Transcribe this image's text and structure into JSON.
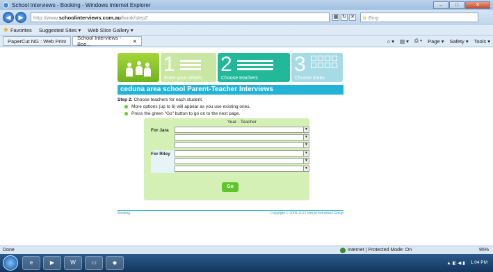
{
  "window": {
    "title": "School Interviews - Booking - Windows Internet Explorer",
    "buttons": [
      "–",
      "□",
      "✕"
    ]
  },
  "address": {
    "url_prefix": "http://www.",
    "url_domain": "schoolinterviews.com.au",
    "url_path": "/book/step2",
    "search_brand": "b",
    "search_placeholder": "Bing"
  },
  "favorites": {
    "items": [
      "Favorites",
      "Suggested Sites ▾",
      "Web Slice Gallery ▾"
    ]
  },
  "tabs": [
    {
      "label": "PaperCut NG : Web Print",
      "active": false
    },
    {
      "label": "School Interviews - Boo...",
      "active": true
    }
  ],
  "command_bar": [
    "Page ▾",
    "Safety ▾",
    "Tools ▾"
  ],
  "steps": [
    {
      "number": "1",
      "label": "Enter your details"
    },
    {
      "number": "2",
      "label": "Choose teachers"
    },
    {
      "number": "3",
      "label": "Choose times"
    }
  ],
  "page": {
    "heading": "ceduna area school Parent-Teacher Interviews",
    "step_bold": "Step 2:",
    "step_text": " Choose teachers for each student.",
    "bullets": [
      "More options (up to 6) will appear as you use existing ones.",
      "Press the green \"Go\" button to go on to the next page."
    ],
    "column_header": "Year - Teacher",
    "students": [
      {
        "label": "For Jara"
      },
      {
        "label": "For Riley"
      }
    ],
    "go_label": "Go"
  },
  "footer": {
    "left": "Booking",
    "right": "Copyright © 2009-2012 Virtual Industries Group"
  },
  "status": {
    "text": "Done",
    "zone": "Internet | Protected Mode: On",
    "zoom": "95%"
  },
  "taskbar": {
    "time": "1:04 PM"
  },
  "colors": {
    "school_header": "#23b3d6",
    "step2_active": "#22b99a",
    "go_button": "#5fc42a",
    "form_panel": "#d5f0b4"
  }
}
